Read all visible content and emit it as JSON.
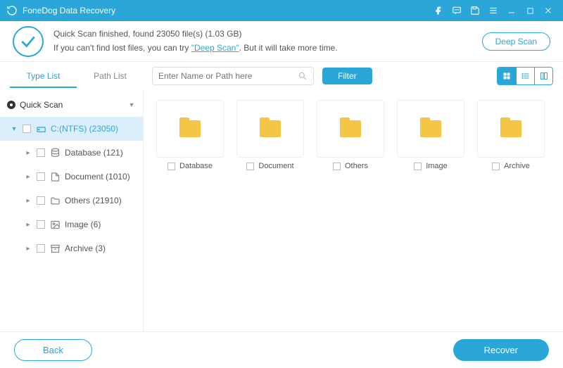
{
  "app": {
    "title": "FoneDog Data Recovery"
  },
  "status": {
    "line1_pre": "Quick Scan finished, found ",
    "file_count": "23050",
    "line1_mid": " file(s) (",
    "size": "1.03 GB",
    "line1_post": ")",
    "line2_pre": "If you can't find lost files, you can try ",
    "deep_scan_link": "\"Deep Scan\"",
    "line2_post": ". But it will take more time.",
    "deep_scan_button": "Deep Scan"
  },
  "tabs": {
    "type_list": "Type List",
    "path_list": "Path List"
  },
  "search": {
    "placeholder": "Enter Name or Path here"
  },
  "filter_label": "Filter",
  "tree": {
    "root": "Quick Scan",
    "drive": "C:(NTFS) (23050)",
    "children": [
      {
        "label": "Database (121)",
        "icon": "database"
      },
      {
        "label": "Document (1010)",
        "icon": "document"
      },
      {
        "label": "Others (21910)",
        "icon": "folder"
      },
      {
        "label": "Image (6)",
        "icon": "image"
      },
      {
        "label": "Archive (3)",
        "icon": "archive"
      }
    ]
  },
  "folders": [
    {
      "name": "Database"
    },
    {
      "name": "Document"
    },
    {
      "name": "Others"
    },
    {
      "name": "Image"
    },
    {
      "name": "Archive"
    }
  ],
  "footer": {
    "back": "Back",
    "recover": "Recover"
  }
}
